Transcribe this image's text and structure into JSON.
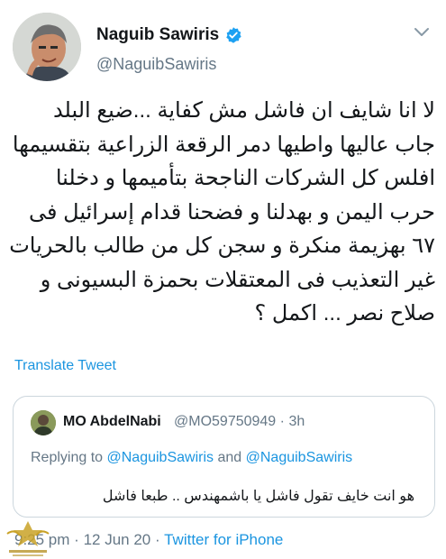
{
  "author": {
    "name": "Naguib Sawiris",
    "handle": "@NaguibSawiris",
    "verified_color": "#1da1f2"
  },
  "tweet": {
    "lines": [
      "لا انا شايف ان فاشل مش كفاية ...ضيع البلد",
      "جاب عاليها واطيها دمر الرقعة الزراعية بتقسيمها",
      "افلس كل الشركات الناجحة بتأميمها و دخلنا",
      "حرب اليمن و بهدلنا و فضحنا قدام إسرائيل فى",
      "٦٧ بهزيمة منكرة و سجن كل من طالب بالحريات",
      "غير التعذيب فى المعتقلات بحمزة البسيونى و",
      "صلاح نصر ... اكمل ؟"
    ],
    "translate_label": "Translate Tweet"
  },
  "quoted": {
    "name": "MO AbdelNabi",
    "handle": "@MO59750949",
    "separator": "·",
    "time": "3h",
    "reply_prefix": "Replying to",
    "mention_1": "@NaguibSawiris",
    "reply_and": "and",
    "mention_2": "@NaguibSawiris",
    "text": "هو انت خايف تقول فاشل يا باشمهندس .. طبعا فاشل"
  },
  "meta": {
    "time": "9:25 pm",
    "separator": "·",
    "date": "12 Jun 20",
    "source": "Twitter for iPhone"
  },
  "icons": {
    "verified": "verified-badge-icon",
    "more": "chevron-down-icon"
  },
  "colors": {
    "link": "#1b95e0",
    "secondary_text": "#657786",
    "border": "#ccd6dd"
  }
}
